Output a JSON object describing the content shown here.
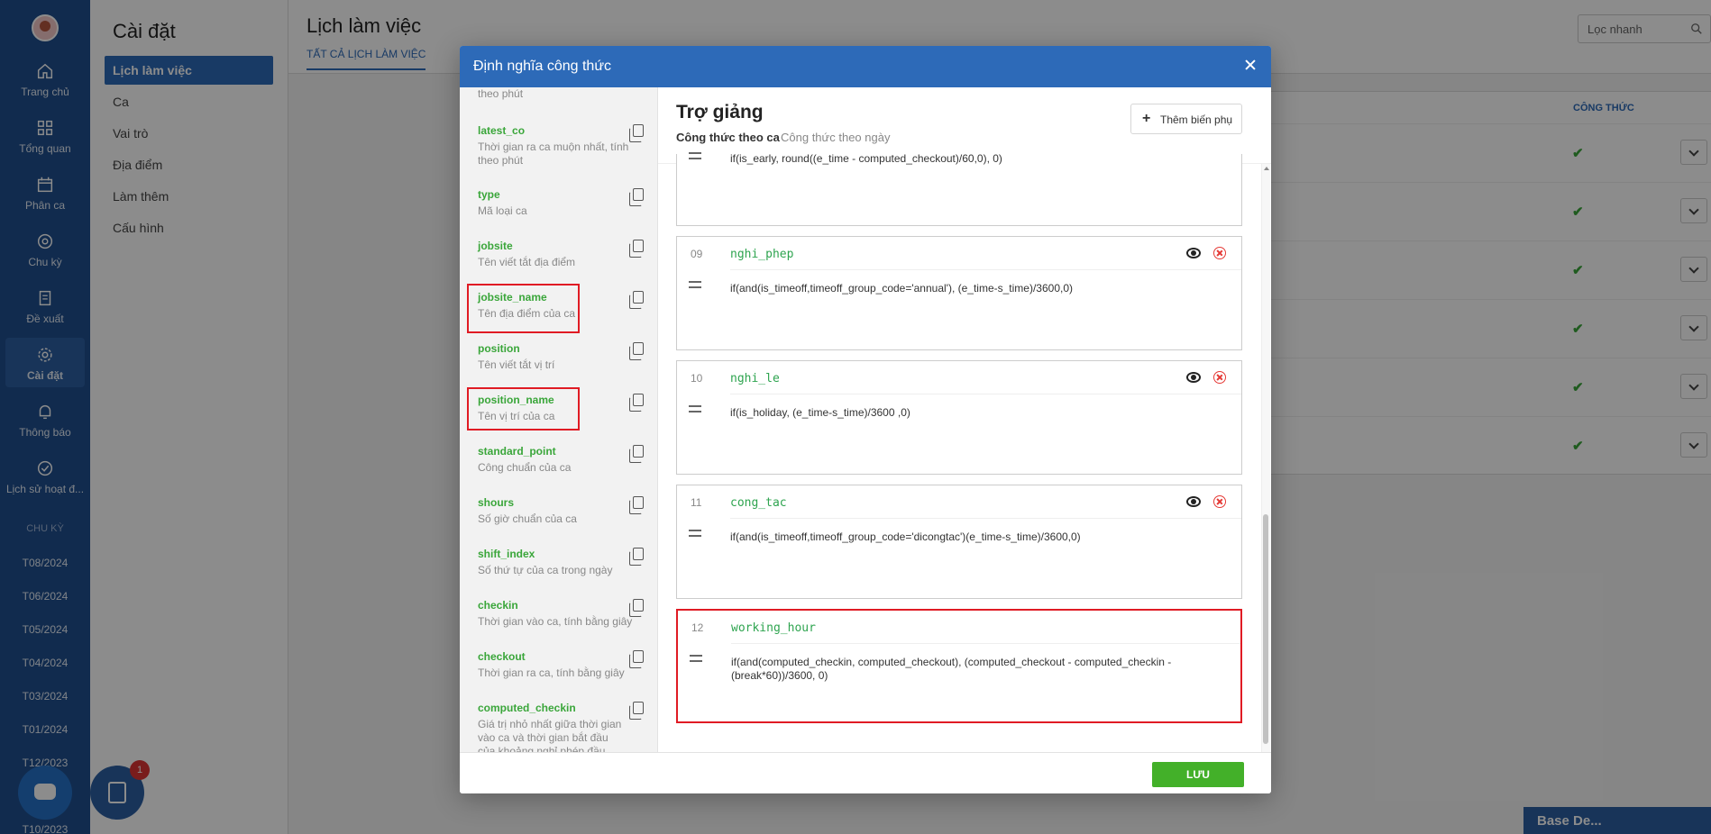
{
  "rail": {
    "items": [
      {
        "label": "Trang chủ",
        "icon": "home-icon"
      },
      {
        "label": "Tổng quan",
        "icon": "grid-icon"
      },
      {
        "label": "Phân ca",
        "icon": "calendar-icon"
      },
      {
        "label": "Chu kỳ",
        "icon": "cycle-icon"
      },
      {
        "label": "Đề xuất",
        "icon": "document-icon"
      },
      {
        "label": "Cài đặt",
        "icon": "gear-icon"
      },
      {
        "label": "Thông báo",
        "icon": "bell-icon"
      },
      {
        "label": "Lịch sử hoạt đ...",
        "icon": "check-circle-icon"
      }
    ],
    "section_label": "CHU KỲ",
    "periods": [
      "T08/2024",
      "T06/2024",
      "T05/2024",
      "T04/2024",
      "T03/2024",
      "T01/2024",
      "T12/2023",
      "T10/2023"
    ]
  },
  "subnav": {
    "title": "Cài đặt",
    "items": [
      "Lịch làm việc",
      "Ca",
      "Vai trò",
      "Địa điểm",
      "Làm thêm",
      "Cấu hình"
    ]
  },
  "main": {
    "title": "Lịch làm việc",
    "tab": "TẤT CẢ LỊCH LÀM VIỆC",
    "search_placeholder": "Lọc nhanh",
    "table_header": "CÔNG THỨC"
  },
  "modal": {
    "title": "Định nghĩa công thức",
    "variables": [
      {
        "name": "",
        "desc": "theo phút"
      },
      {
        "name": "latest_co",
        "desc": "Thời gian ra ca muộn nhất, tính theo phút"
      },
      {
        "name": "type",
        "desc": "Mã loại ca"
      },
      {
        "name": "jobsite",
        "desc": "Tên viết tắt địa điểm"
      },
      {
        "name": "jobsite_name",
        "desc": "Tên địa điểm của ca"
      },
      {
        "name": "position",
        "desc": "Tên viết tắt vị trí"
      },
      {
        "name": "position_name",
        "desc": "Tên vị trí của ca"
      },
      {
        "name": "standard_point",
        "desc": "Công chuẩn của ca"
      },
      {
        "name": "shours",
        "desc": "Số giờ chuẩn của ca"
      },
      {
        "name": "shift_index",
        "desc": "Số thứ tự của ca trong ngày"
      },
      {
        "name": "checkin",
        "desc": "Thời gian vào ca, tính bằng giây"
      },
      {
        "name": "checkout",
        "desc": "Thời gian ra ca, tính bằng giây"
      },
      {
        "name": "computed_checkin",
        "desc": "Giá trị nhỏ nhất giữa thời gian vào ca và thời gian bắt đầu của khoảng nghỉ phép đầu tiên, tính"
      }
    ],
    "formula_title": "Trợ giảng",
    "tab_shift": "Công thức theo ca",
    "tab_day": "Công thức theo ngày",
    "add_button": "Thêm biến phụ",
    "partial_expr": "if(is_early, round((e_time - computed_checkout)/60,0), 0)",
    "formulas": [
      {
        "num": "09",
        "var": "nghi_phep",
        "expr": "if(and(is_timeoff,timeoff_group_code='annual'), (e_time-s_time)/3600,0)"
      },
      {
        "num": "10",
        "var": "nghi_le",
        "expr": "if(is_holiday, (e_time-s_time)/3600 ,0)"
      },
      {
        "num": "11",
        "var": "cong_tac",
        "expr": "if(and(is_timeoff,timeoff_group_code='dicongtac')(e_time-s_time)/3600,0)"
      },
      {
        "num": "12",
        "var": "working_hour",
        "expr": "if(and(computed_checkin, computed_checkout), (computed_checkout - computed_checkin - (break*60))/3600, 0)"
      }
    ],
    "save_label": "LƯU"
  },
  "floating": {
    "task_badge": "1",
    "dock_label": "Base De..."
  }
}
